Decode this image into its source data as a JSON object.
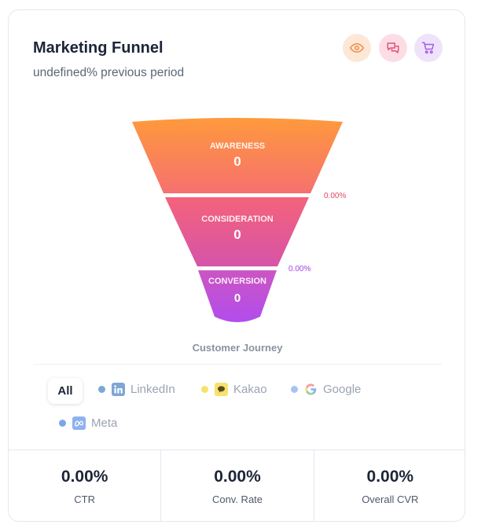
{
  "header": {
    "title": "Marketing Funnel",
    "subtitle": "undefined% previous period"
  },
  "actions": {
    "icons": [
      "eye-icon",
      "chat-icon",
      "cart-icon"
    ],
    "colors": {
      "eye": "#f08a3c",
      "chat": "#e0527a",
      "cart": "#a65ce6"
    }
  },
  "funnel": {
    "stages": [
      {
        "label": "AWARENESS",
        "value": "0"
      },
      {
        "label": "CONSIDERATION",
        "value": "0"
      },
      {
        "label": "CONVERSION",
        "value": "0"
      }
    ],
    "rates": [
      {
        "text": "0.00%",
        "color": "#e0475e"
      },
      {
        "text": "0.00%",
        "color": "#a343e0"
      }
    ],
    "caption": "Customer Journey",
    "colors": {
      "top": "#ff9a3c",
      "middle": "#ec5b84",
      "bottom": "#b64be9"
    }
  },
  "filters": [
    {
      "label": "All",
      "active": true
    },
    {
      "label": "LinkedIn",
      "dot": "#7ea6d6",
      "icon": "linkedin-icon"
    },
    {
      "label": "Kakao",
      "dot": "#f7e26b",
      "icon": "kakao-icon"
    },
    {
      "label": "Google",
      "dot": "#a9c2ef",
      "icon": "google-icon"
    },
    {
      "label": "Meta",
      "dot": "#7ea6e6",
      "icon": "meta-icon"
    }
  ],
  "stats": [
    {
      "value": "0.00%",
      "label": "CTR"
    },
    {
      "value": "0.00%",
      "label": "Conv. Rate"
    },
    {
      "value": "0.00%",
      "label": "Overall CVR"
    }
  ]
}
